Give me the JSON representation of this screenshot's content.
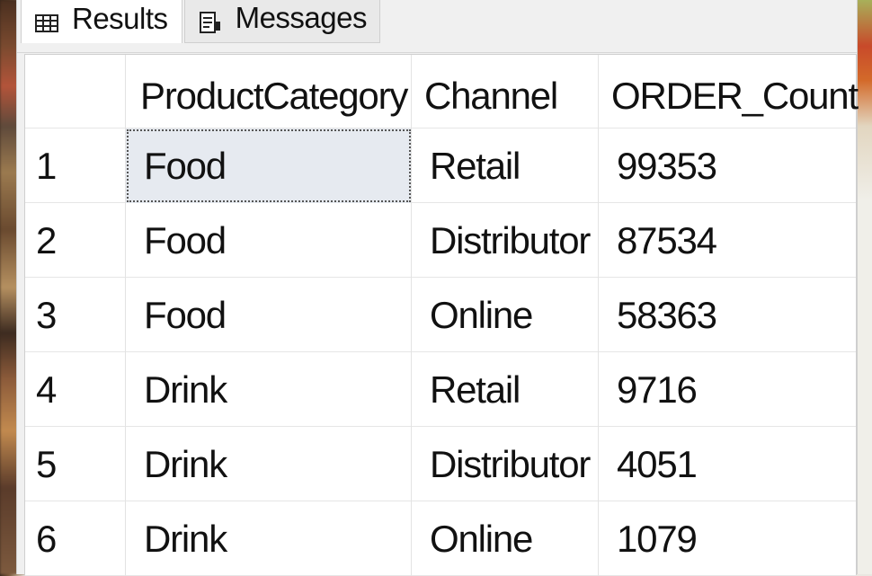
{
  "tabs": [
    {
      "label": "Results",
      "icon": "grid-icon"
    },
    {
      "label": "Messages",
      "icon": "messages-icon"
    }
  ],
  "table": {
    "columns": [
      "ProductCategory",
      "Channel",
      "ORDER_Count"
    ],
    "rows": [
      {
        "num": "1",
        "ProductCategory": "Food",
        "Channel": "Retail",
        "ORDER_Count": "99353"
      },
      {
        "num": "2",
        "ProductCategory": "Food",
        "Channel": "Distributor",
        "ORDER_Count": "87534"
      },
      {
        "num": "3",
        "ProductCategory": "Food",
        "Channel": "Online",
        "ORDER_Count": "58363"
      },
      {
        "num": "4",
        "ProductCategory": "Drink",
        "Channel": "Retail",
        "ORDER_Count": "9716"
      },
      {
        "num": "5",
        "ProductCategory": "Drink",
        "Channel": "Distributor",
        "ORDER_Count": "4051"
      },
      {
        "num": "6",
        "ProductCategory": "Drink",
        "Channel": "Online",
        "ORDER_Count": "1079"
      }
    ]
  },
  "colors": {
    "selected_cell_bg": "#e6eaf0",
    "grid_line": "#e3e3e3",
    "tab_bg": "#f0f0f0"
  }
}
